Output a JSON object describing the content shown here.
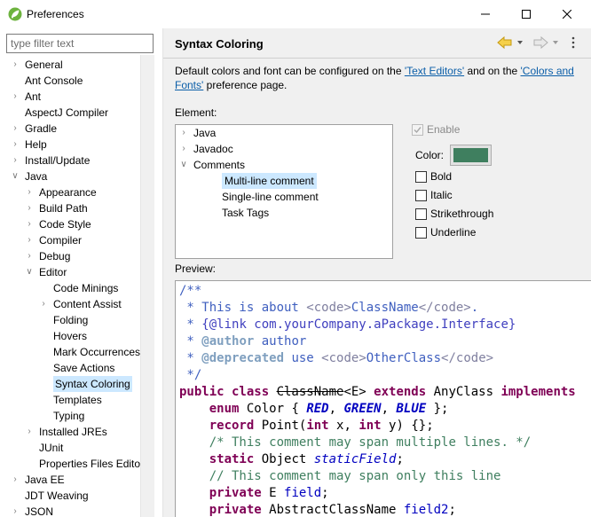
{
  "window": {
    "title": "Preferences",
    "logo_icon": "eclipse-spring-icon",
    "controls": [
      "minimize-icon",
      "maximize-icon",
      "close-icon"
    ]
  },
  "filter": {
    "placeholder": "type filter text",
    "value": ""
  },
  "tree": {
    "items": [
      {
        "label": "General",
        "depth": 0,
        "twisty": "collapsed"
      },
      {
        "label": "Ant Console",
        "depth": 0,
        "twisty": "none"
      },
      {
        "label": "Ant",
        "depth": 0,
        "twisty": "collapsed"
      },
      {
        "label": "AspectJ Compiler",
        "depth": 0,
        "twisty": "none"
      },
      {
        "label": "Gradle",
        "depth": 0,
        "twisty": "collapsed"
      },
      {
        "label": "Help",
        "depth": 0,
        "twisty": "collapsed"
      },
      {
        "label": "Install/Update",
        "depth": 0,
        "twisty": "collapsed"
      },
      {
        "label": "Java",
        "depth": 0,
        "twisty": "expanded"
      },
      {
        "label": "Appearance",
        "depth": 1,
        "twisty": "collapsed"
      },
      {
        "label": "Build Path",
        "depth": 1,
        "twisty": "collapsed"
      },
      {
        "label": "Code Style",
        "depth": 1,
        "twisty": "collapsed"
      },
      {
        "label": "Compiler",
        "depth": 1,
        "twisty": "collapsed"
      },
      {
        "label": "Debug",
        "depth": 1,
        "twisty": "collapsed"
      },
      {
        "label": "Editor",
        "depth": 1,
        "twisty": "expanded"
      },
      {
        "label": "Code Minings",
        "depth": 2,
        "twisty": "none"
      },
      {
        "label": "Content Assist",
        "depth": 2,
        "twisty": "collapsed"
      },
      {
        "label": "Folding",
        "depth": 2,
        "twisty": "none"
      },
      {
        "label": "Hovers",
        "depth": 2,
        "twisty": "none"
      },
      {
        "label": "Mark Occurrences",
        "depth": 2,
        "twisty": "none"
      },
      {
        "label": "Save Actions",
        "depth": 2,
        "twisty": "none"
      },
      {
        "label": "Syntax Coloring",
        "depth": 2,
        "twisty": "none",
        "selected": true
      },
      {
        "label": "Templates",
        "depth": 2,
        "twisty": "none"
      },
      {
        "label": "Typing",
        "depth": 2,
        "twisty": "none"
      },
      {
        "label": "Installed JREs",
        "depth": 1,
        "twisty": "collapsed"
      },
      {
        "label": "JUnit",
        "depth": 1,
        "twisty": "none"
      },
      {
        "label": "Properties Files Edito",
        "depth": 1,
        "twisty": "none"
      },
      {
        "label": "Java EE",
        "depth": 0,
        "twisty": "collapsed"
      },
      {
        "label": "JDT Weaving",
        "depth": 0,
        "twisty": "none"
      },
      {
        "label": "JSON",
        "depth": 0,
        "twisty": "collapsed"
      }
    ]
  },
  "page": {
    "title": "Syntax Coloring",
    "nav_icons": [
      "back-arrow-icon",
      "back-menu-chevron-icon",
      "forward-arrow-icon",
      "forward-menu-chevron-icon",
      "view-menu-icon"
    ],
    "description_pre": "Default colors and font can be configured on the ",
    "link1": "'Text Editors'",
    "description_mid": " and on the ",
    "link2": "'Colors and Fonts'",
    "description_post": " preference page."
  },
  "element": {
    "label": "Element:",
    "items": [
      {
        "label": "Java",
        "depth": 0,
        "twisty": "collapsed"
      },
      {
        "label": "Javadoc",
        "depth": 0,
        "twisty": "collapsed"
      },
      {
        "label": "Comments",
        "depth": 0,
        "twisty": "expanded"
      },
      {
        "label": "Multi-line comment",
        "depth": 1,
        "twisty": "none",
        "selected": true
      },
      {
        "label": "Single-line comment",
        "depth": 1,
        "twisty": "none"
      },
      {
        "label": "Task Tags",
        "depth": 1,
        "twisty": "none"
      }
    ]
  },
  "options": {
    "enable_label": "Enable",
    "enable_checked": true,
    "color_label": "Color:",
    "color_value": "#3f7f5f",
    "bold_label": "Bold",
    "italic_label": "Italic",
    "strike_label": "Strikethrough",
    "underline_label": "Underline"
  },
  "preview": {
    "label": "Preview:",
    "lines": [
      [
        [
          "/**",
          "jdoc"
        ]
      ],
      [
        [
          " * This is about ",
          "jdoc"
        ],
        [
          "<code>",
          "html"
        ],
        [
          "ClassName",
          "jdoc"
        ],
        [
          "</code>",
          "html"
        ],
        [
          ".",
          "jdoc"
        ]
      ],
      [
        [
          " * ",
          "jdoc"
        ],
        [
          "{@link com.yourCompany.aPackage.Interface}",
          "link"
        ]
      ],
      [
        [
          " * ",
          "jdoc"
        ],
        [
          "@author",
          "tag"
        ],
        [
          " author",
          "jdoc"
        ]
      ],
      [
        [
          " * ",
          "jdoc"
        ],
        [
          "@deprecated",
          "tag"
        ],
        [
          " use ",
          "jdoc"
        ],
        [
          "<code>",
          "html"
        ],
        [
          "OtherClass",
          "jdoc"
        ],
        [
          "</code>",
          "html"
        ]
      ],
      [
        [
          " */",
          "jdoc"
        ]
      ],
      [
        [
          "public class ",
          "kw"
        ],
        [
          "ClassName",
          "strike"
        ],
        [
          "<E> ",
          "plain"
        ],
        [
          "extends ",
          "kw"
        ],
        [
          "AnyClass ",
          "plain"
        ],
        [
          "implements",
          "kw"
        ]
      ],
      [
        [
          "    ",
          "plain"
        ],
        [
          "enum ",
          "kw"
        ],
        [
          "Color { ",
          "plain"
        ],
        [
          "RED",
          "enum"
        ],
        [
          ", ",
          "plain"
        ],
        [
          "GREEN",
          "enum"
        ],
        [
          ", ",
          "plain"
        ],
        [
          "BLUE",
          "enum"
        ],
        [
          " };",
          "plain"
        ]
      ],
      [
        [
          "    ",
          "plain"
        ],
        [
          "record ",
          "kw"
        ],
        [
          "Point(",
          "plain"
        ],
        [
          "int ",
          "kw"
        ],
        [
          "x, ",
          "plain"
        ],
        [
          "int ",
          "kw"
        ],
        [
          "y) {};",
          "plain"
        ]
      ],
      [
        [
          "    ",
          "plain"
        ],
        [
          "/* This comment may span multiple lines. */",
          "cm"
        ]
      ],
      [
        [
          "    ",
          "plain"
        ],
        [
          "static ",
          "kw"
        ],
        [
          "Object ",
          "plain"
        ],
        [
          "staticField",
          "static"
        ],
        [
          ";",
          "plain"
        ]
      ],
      [
        [
          "    ",
          "plain"
        ],
        [
          "// This comment may span only this line",
          "cm"
        ]
      ],
      [
        [
          "    ",
          "plain"
        ],
        [
          "private ",
          "kw"
        ],
        [
          "E ",
          "plain"
        ],
        [
          "field",
          "field"
        ],
        [
          ";",
          "plain"
        ]
      ],
      [
        [
          "    ",
          "plain"
        ],
        [
          "private ",
          "kw"
        ],
        [
          "AbstractClassName ",
          "plain"
        ],
        [
          "field2",
          "field"
        ],
        [
          ";",
          "plain"
        ]
      ]
    ]
  }
}
